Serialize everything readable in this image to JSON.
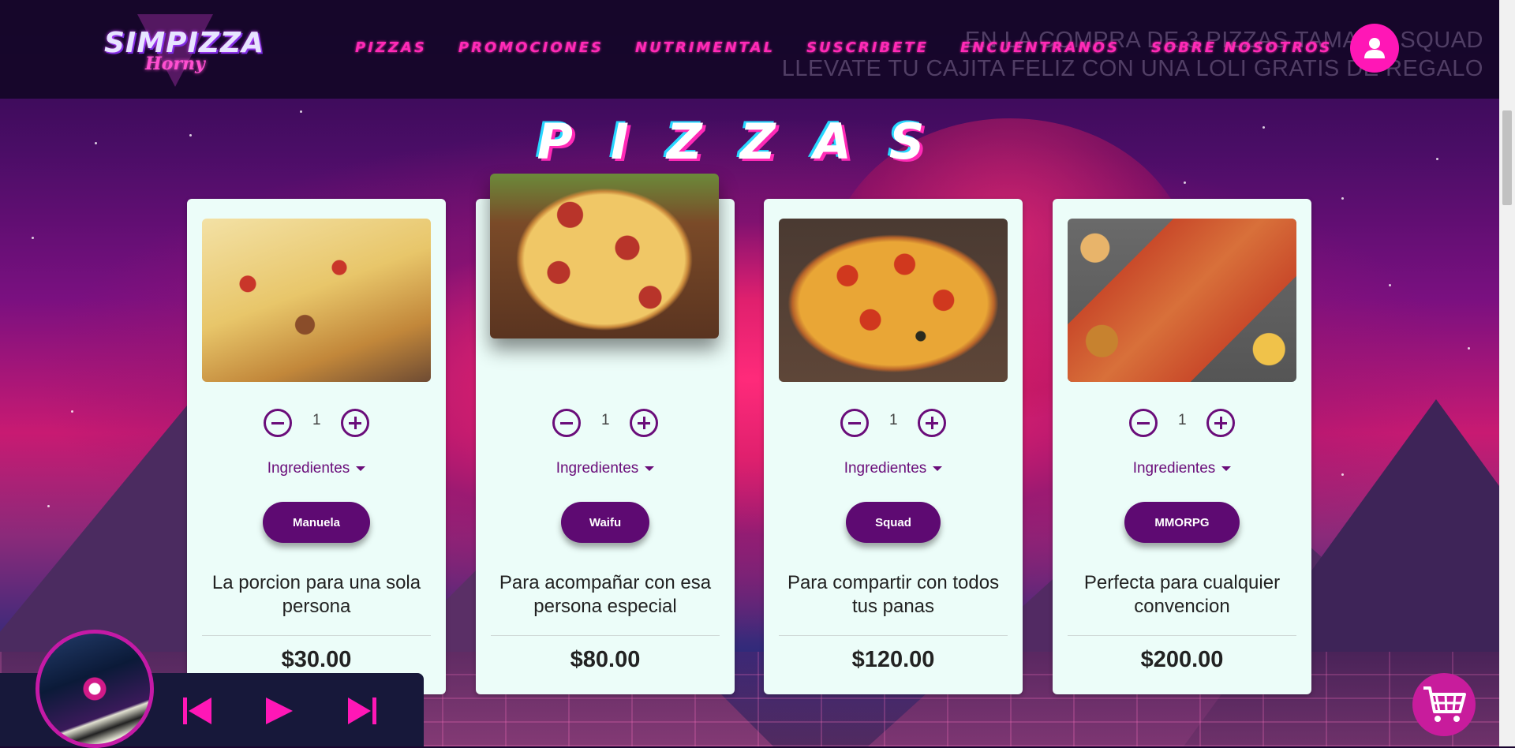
{
  "header": {
    "logo_main": "SIMPIZZA",
    "logo_sub": "Horny",
    "marquee_line1": "EN LA COMPRA DE 3 PIZZAS TAMAÑO SQUAD",
    "marquee_line2": "LLEVATE TU CAJITA FELIZ CON UNA LOLI GRATIS DE REGALO",
    "nav": [
      "PIZZAS",
      "PROMOCIONES",
      "NUTRIMENTAL",
      "SUSCRIBETE",
      "ENCUENTRANOS",
      "SOBRE NOSOTROS"
    ],
    "avatar_icon": "user-icon"
  },
  "section_title": "PIZZAS",
  "products": [
    {
      "name": "Manuela",
      "qty": "1",
      "ingredients_label": "Ingredientes",
      "description": "La porcion para una sola persona",
      "price": "$30.00",
      "image": "pizza-slice-photo"
    },
    {
      "name": "Waifu",
      "qty": "1",
      "ingredients_label": "Ingredientes",
      "description": "Para acompañar con esa persona especial",
      "price": "$80.00",
      "image": "pepperoni-pizza-photo"
    },
    {
      "name": "Squad",
      "qty": "1",
      "ingredients_label": "Ingredientes",
      "description": "Para compartir con todos tus panas",
      "price": "$120.00",
      "image": "supreme-pizza-photo"
    },
    {
      "name": "MMORPG",
      "qty": "1",
      "ingredients_label": "Ingredientes",
      "description": "Perfecta para cualquier convencion",
      "price": "$200.00",
      "image": "party-pizza-combo-photo"
    }
  ],
  "player": {
    "album_art": "synthwave-album-art",
    "controls": [
      "previous-icon",
      "play-icon",
      "next-icon"
    ]
  },
  "cart_icon": "cart-icon",
  "colors": {
    "accent": "#ff17b6",
    "button": "#5e0a72",
    "card_bg": "#ecfdf9",
    "header_bg": "#140628"
  }
}
